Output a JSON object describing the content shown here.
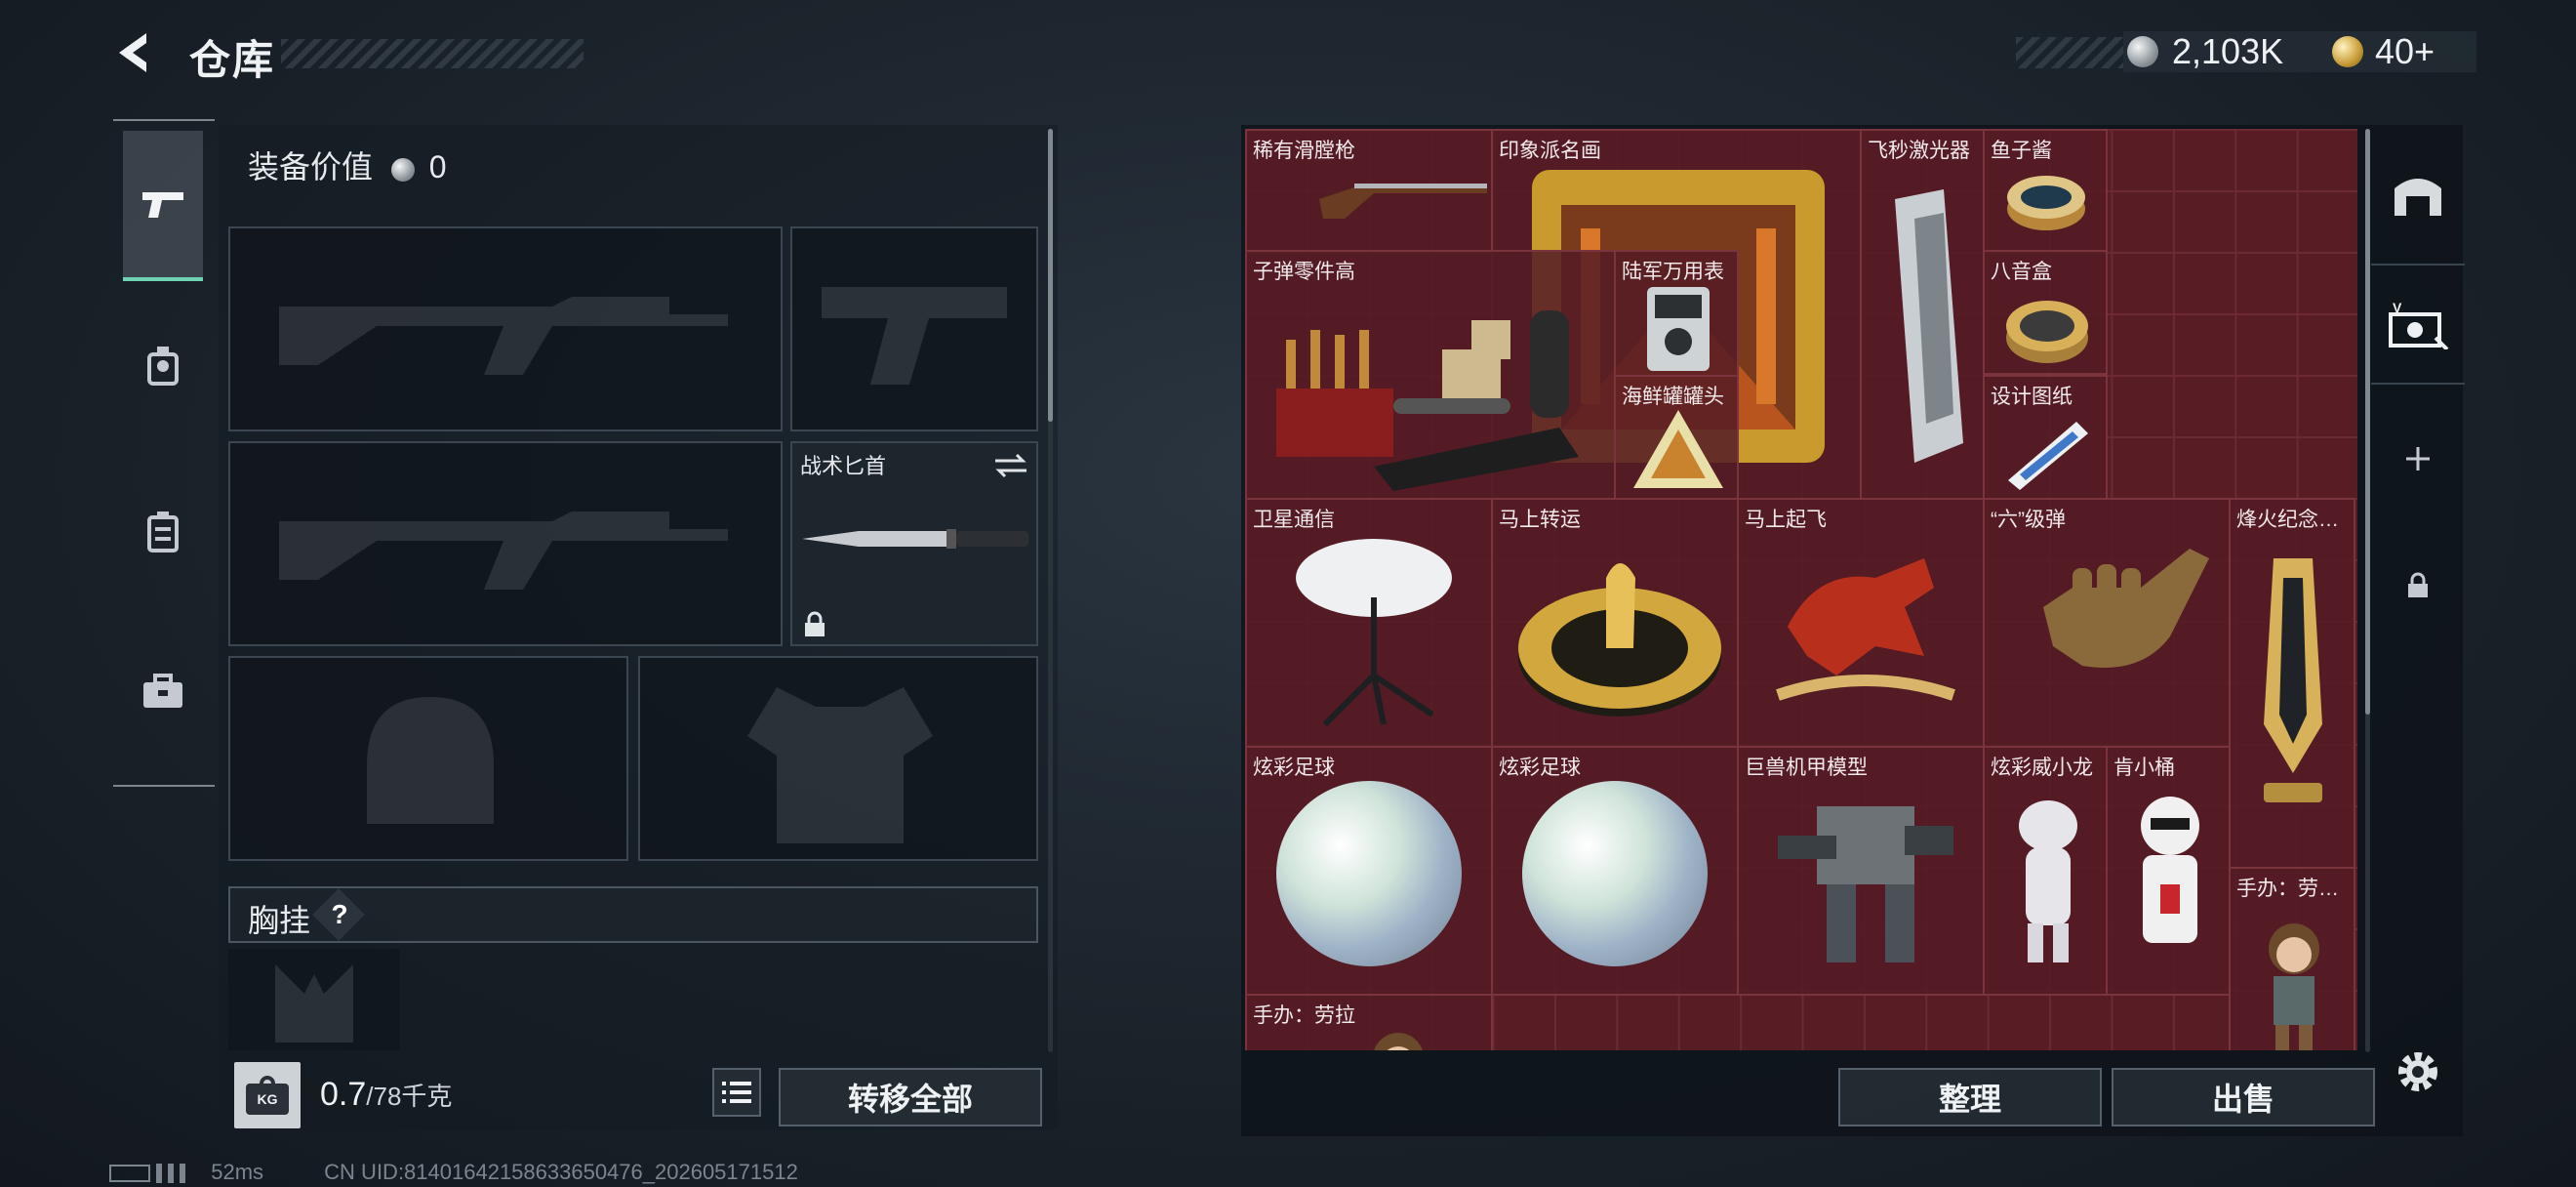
{
  "header": {
    "title": "仓库",
    "currency_silver": "2,103K",
    "currency_gold": "40+"
  },
  "left_panel": {
    "equipment_value_label": "装备价值",
    "equipment_value": "0",
    "slots": {
      "primary_weapon_1": "",
      "sidearm": "",
      "primary_weapon_2": "",
      "melee": "战术匕首",
      "helmet": "",
      "armor": ""
    },
    "chest_rig_label": "胸挂",
    "chest_rig_help": "?",
    "weight": "0.7",
    "weight_max": "/78千克",
    "kg_badge": "KG",
    "transfer_all": "转移全部"
  },
  "warehouse": {
    "items": [
      {
        "label": "稀有滑膛枪",
        "art": "musket"
      },
      {
        "label": "印象派名画",
        "art": "painting"
      },
      {
        "label": "飞秒激光器",
        "art": "laser"
      },
      {
        "label": "鱼子酱",
        "art": "caviar"
      },
      {
        "label": "子弹零件高",
        "art": "ammo-parts"
      },
      {
        "label": "陆军万用表",
        "art": "multimeter"
      },
      {
        "label": "八音盒",
        "art": "music-box"
      },
      {
        "label": "海鲜罐罐头",
        "art": "can"
      },
      {
        "label": "设计图纸",
        "art": "blueprint"
      },
      {
        "label": "卫星通信",
        "art": "satellite-dish"
      },
      {
        "label": "马上转运",
        "art": "horse-wheel"
      },
      {
        "label": "马上起飞",
        "art": "red-horse"
      },
      {
        "label": "“六”级弹",
        "art": "hand-sign"
      },
      {
        "label": "烽火纪念…",
        "art": "trophy"
      },
      {
        "label": "炫彩足球",
        "art": "ball"
      },
      {
        "label": "炫彩足球",
        "art": "ball"
      },
      {
        "label": "巨兽机甲模型",
        "art": "mech"
      },
      {
        "label": "炫彩威小龙",
        "art": "dragon-figure"
      },
      {
        "label": "肯小桶",
        "art": "colonel-figure"
      },
      {
        "label": "手办：劳…",
        "art": "lara-figure"
      },
      {
        "label": "手办：劳拉",
        "art": "lara-figure"
      }
    ],
    "sort_button": "整理",
    "sell_button": "出售"
  },
  "status_bar": {
    "ping": "52ms",
    "uid": "CN UID:8140164215863365047​6_202605171512"
  },
  "colors": {
    "accent": "#6fd3b3",
    "grid_bg": "#571c24",
    "grid_line": "#7a343d"
  }
}
